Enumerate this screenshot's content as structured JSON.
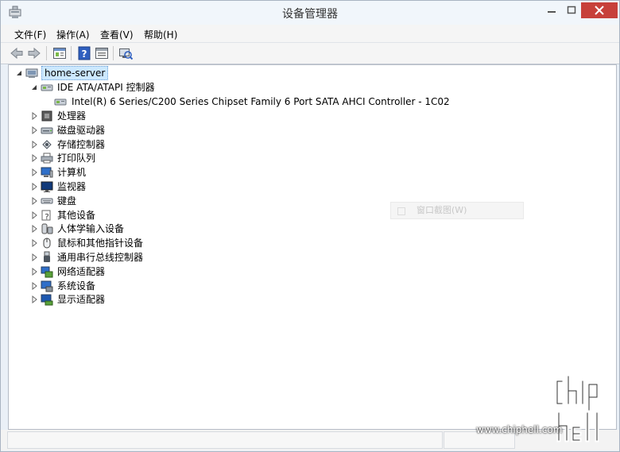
{
  "window": {
    "title": "设备管理器"
  },
  "menu": [
    "文件(F)",
    "操作(A)",
    "查看(V)",
    "帮助(H)"
  ],
  "toolbar": {
    "icons": [
      "back-arrow-icon",
      "forward-arrow-icon",
      "properties-pane-icon",
      "help-icon",
      "details-view-icon",
      "scan-hardware-icon"
    ]
  },
  "tree": {
    "root": "home-server",
    "nodes": [
      {
        "label": "IDE ATA/ATAPI 控制器",
        "expanded": true,
        "icon": "ide-controller-icon",
        "children": [
          "Intel(R) 6 Series/C200 Series Chipset Family 6 Port SATA AHCI Controller - 1C02"
        ]
      },
      {
        "label": "处理器",
        "icon": "processor-icon"
      },
      {
        "label": "磁盘驱动器",
        "icon": "disk-drive-icon"
      },
      {
        "label": "存储控制器",
        "icon": "storage-controller-icon"
      },
      {
        "label": "打印队列",
        "icon": "printer-icon"
      },
      {
        "label": "计算机",
        "icon": "computer-icon"
      },
      {
        "label": "监视器",
        "icon": "monitor-icon"
      },
      {
        "label": "键盘",
        "icon": "keyboard-icon"
      },
      {
        "label": "其他设备",
        "icon": "other-devices-icon"
      },
      {
        "label": "人体学输入设备",
        "icon": "hid-icon"
      },
      {
        "label": "鼠标和其他指针设备",
        "icon": "mouse-icon"
      },
      {
        "label": "通用串行总线控制器",
        "icon": "usb-icon"
      },
      {
        "label": "网络适配器",
        "icon": "network-adapter-icon"
      },
      {
        "label": "系统设备",
        "icon": "system-devices-icon"
      },
      {
        "label": "显示适配器",
        "icon": "display-adapter-icon"
      }
    ]
  },
  "ghost_menu": {
    "label": "窗口截图(W)"
  },
  "watermark": {
    "text": "www.chiphell.com",
    "logo": "chip hell"
  },
  "colors": {
    "close": "#c7413a",
    "selection": "#cce8ff"
  }
}
